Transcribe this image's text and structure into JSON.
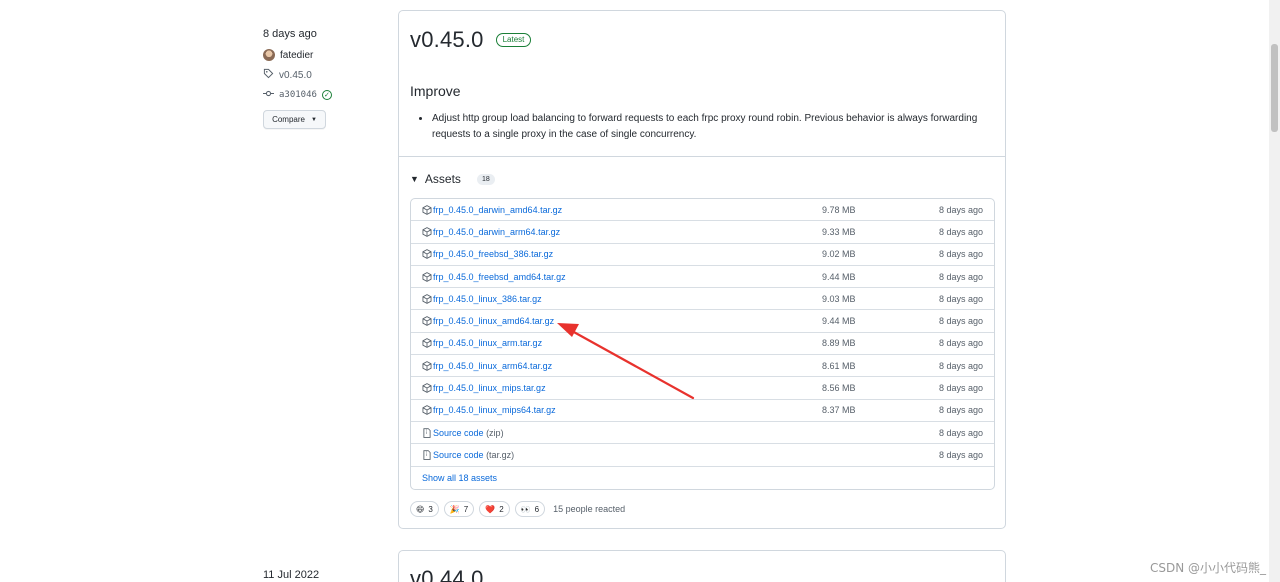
{
  "release": {
    "date": "8 days ago",
    "author": "fatedier",
    "tag": "v0.45.0",
    "commit": "a301046",
    "compare_label": "Compare",
    "version": "v0.45.0",
    "badge": "Latest",
    "section_title": "Improve",
    "notes": [
      "Adjust http group load balancing to forward requests to each frpc proxy round robin. Previous behavior is always forwarding requests to a single proxy in the case of single concurrency."
    ],
    "assets_title": "Assets",
    "assets_count": "18",
    "assets": [
      {
        "name": "frp_0.45.0_darwin_amd64.tar.gz",
        "size": "9.78 MB",
        "date": "8 days ago",
        "icon": "package-icon"
      },
      {
        "name": "frp_0.45.0_darwin_arm64.tar.gz",
        "size": "9.33 MB",
        "date": "8 days ago",
        "icon": "package-icon"
      },
      {
        "name": "frp_0.45.0_freebsd_386.tar.gz",
        "size": "9.02 MB",
        "date": "8 days ago",
        "icon": "package-icon"
      },
      {
        "name": "frp_0.45.0_freebsd_amd64.tar.gz",
        "size": "9.44 MB",
        "date": "8 days ago",
        "icon": "package-icon"
      },
      {
        "name": "frp_0.45.0_linux_386.tar.gz",
        "size": "9.03 MB",
        "date": "8 days ago",
        "icon": "package-icon"
      },
      {
        "name": "frp_0.45.0_linux_amd64.tar.gz",
        "size": "9.44 MB",
        "date": "8 days ago",
        "icon": "package-icon"
      },
      {
        "name": "frp_0.45.0_linux_arm.tar.gz",
        "size": "8.89 MB",
        "date": "8 days ago",
        "icon": "package-icon"
      },
      {
        "name": "frp_0.45.0_linux_arm64.tar.gz",
        "size": "8.61 MB",
        "date": "8 days ago",
        "icon": "package-icon"
      },
      {
        "name": "frp_0.45.0_linux_mips.tar.gz",
        "size": "8.56 MB",
        "date": "8 days ago",
        "icon": "package-icon"
      },
      {
        "name": "frp_0.45.0_linux_mips64.tar.gz",
        "size": "8.37 MB",
        "date": "8 days ago",
        "icon": "package-icon"
      }
    ],
    "source_assets": [
      {
        "name": "Source code",
        "format": "(zip)",
        "date": "8 days ago",
        "icon": "file-zip-icon"
      },
      {
        "name": "Source code",
        "format": "(tar.gz)",
        "date": "8 days ago",
        "icon": "file-zip-icon"
      }
    ],
    "show_all_label": "Show all 18 assets",
    "reactions": [
      {
        "emoji": "😄",
        "count": "3"
      },
      {
        "emoji": "🎉",
        "count": "7"
      },
      {
        "emoji": "❤️",
        "count": "2"
      },
      {
        "emoji": "👀",
        "count": "6"
      }
    ],
    "reactions_summary": "15 people reacted"
  },
  "next_release": {
    "date": "11 Jul 2022",
    "version": "v0.44.0"
  },
  "watermark": "CSDN @小小代码熊_",
  "colors": {
    "link": "#0969da",
    "latest_badge": "#1a7f37",
    "annotation_arrow": "#e8322d"
  }
}
